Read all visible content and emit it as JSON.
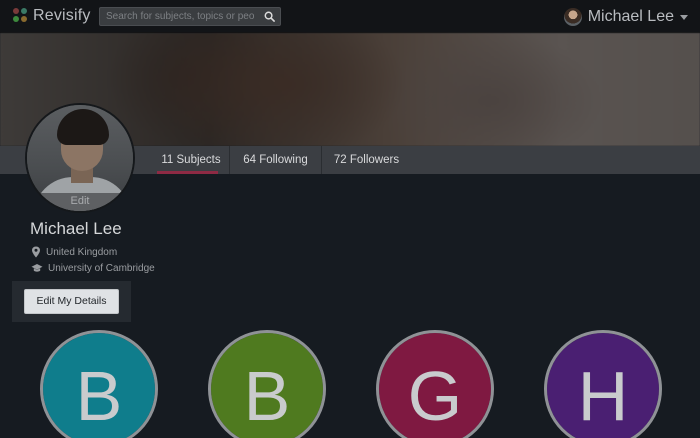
{
  "app": {
    "brand": "Revisify"
  },
  "search": {
    "placeholder": "Search for subjects, topics or people"
  },
  "user": {
    "name": "Michael Lee"
  },
  "stats": [
    {
      "label": "11 Subjects",
      "active": true
    },
    {
      "label": "64 Following",
      "active": false
    },
    {
      "label": "72 Followers",
      "active": false
    }
  ],
  "profile": {
    "avatar_edit_label": "Edit",
    "name": "Michael Lee",
    "location": "United Kingdom",
    "institution": "University of Cambridge",
    "edit_button": "Edit My Details"
  },
  "subjects": [
    {
      "letter": "B",
      "color": "#0f7d8c"
    },
    {
      "letter": "B",
      "color": "#4f7a1f"
    },
    {
      "letter": "G",
      "color": "#7f1941"
    },
    {
      "letter": "H",
      "color": "#4a1f72"
    }
  ]
}
